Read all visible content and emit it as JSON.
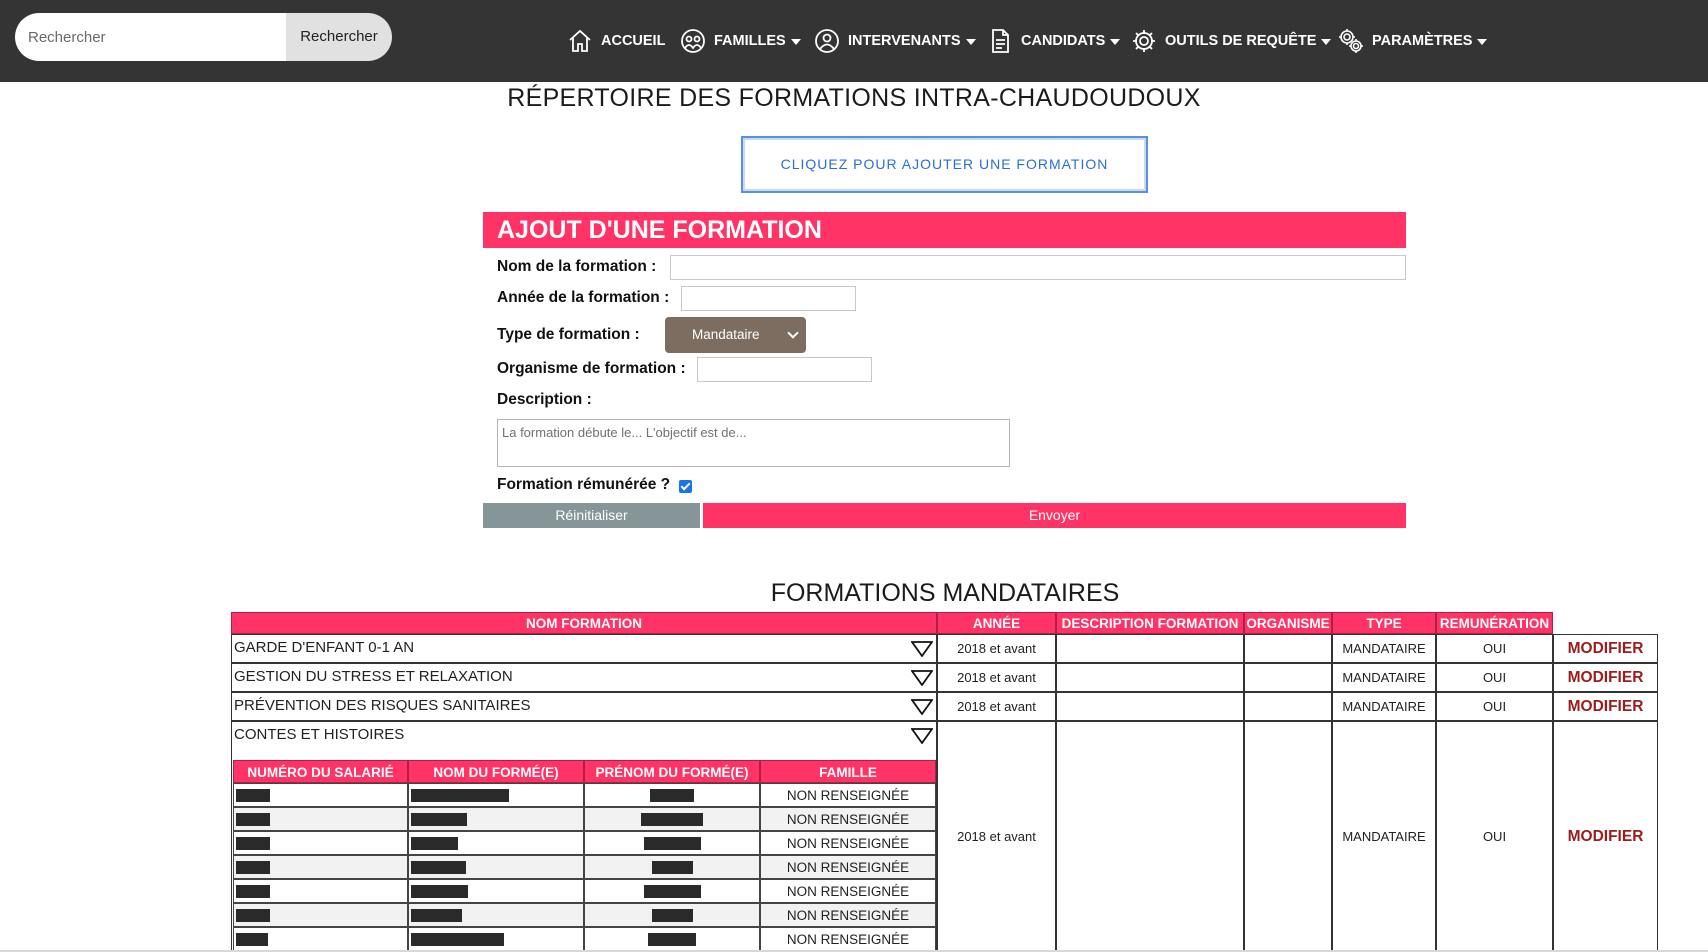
{
  "search": {
    "placeholder": "Rechercher",
    "button_label": "Rechercher"
  },
  "nav": [
    {
      "label": "ACCUEIL",
      "icon": "home-icon",
      "dropdown": false
    },
    {
      "label": "FAMILLES",
      "icon": "family-icon",
      "dropdown": true
    },
    {
      "label": "INTERVENANTS",
      "icon": "user-icon",
      "dropdown": true
    },
    {
      "label": "CANDIDATS",
      "icon": "document-icon",
      "dropdown": true
    },
    {
      "label": "OUTILS DE REQUÊTE",
      "icon": "gear-icon",
      "dropdown": true
    },
    {
      "label": "PARAMÈTRES",
      "icon": "gears-icon",
      "dropdown": true
    }
  ],
  "page_title": "RÉPERTOIRE DES FORMATIONS INTRA-CHAUDOUDOUX",
  "add_button": "CLIQUEZ POUR AJOUTER UNE FORMATION",
  "form": {
    "header": "AJOUT D'UNE FORMATION",
    "name_label": "Nom de la formation :",
    "name_value": "",
    "year_label": "Année de la formation :",
    "year_value": "",
    "type_label": "Type de formation :",
    "type_value": "Mandataire",
    "org_label": "Organisme de formation :",
    "org_value": "",
    "desc_label": "Description :",
    "desc_placeholder": "La formation débute le... L'objectif est de...",
    "paid_label": "Formation rémunérée ?",
    "paid_checked": true,
    "reset_label": "Réinitialiser",
    "submit_label": "Envoyer"
  },
  "section_title": "FORMATIONS MANDATAIRES",
  "table": {
    "headers": [
      "NOM FORMATION",
      "ANNÉE",
      "DESCRIPTION FORMATION",
      "ORGANISME",
      "TYPE",
      "REMUNÉRATION"
    ],
    "rows": [
      {
        "name": "GARDE D'ENFANT 0-1 AN",
        "year": "2018 et avant",
        "description": "",
        "organisme": "",
        "type": "MANDATAIRE",
        "remuneration": "OUI",
        "action": "MODIFIER"
      },
      {
        "name": "GESTION DU STRESS ET RELAXATION",
        "year": "2018 et avant",
        "description": "",
        "organisme": "",
        "type": "MANDATAIRE",
        "remuneration": "OUI",
        "action": "MODIFIER"
      },
      {
        "name": "PRÉVENTION DES RISQUES SANITAIRES",
        "year": "2018 et avant",
        "description": "",
        "organisme": "",
        "type": "MANDATAIRE",
        "remuneration": "OUI",
        "action": "MODIFIER"
      },
      {
        "name": "CONTES ET HISTOIRES",
        "year": "2018 et avant",
        "description": "",
        "organisme": "",
        "type": "MANDATAIRE",
        "remuneration": "OUI",
        "action": "MODIFIER"
      }
    ],
    "sub_headers": [
      "NUMÉRO DU SALARIÉ",
      "NOM DU FORMÉ(E)",
      "PRÉNOM DU FORMÉ(E)",
      "FAMILLE"
    ],
    "sub_rows": [
      {
        "famille": "NON RENSEIGNÉE"
      },
      {
        "famille": "NON RENSEIGNÉE"
      },
      {
        "famille": "NON RENSEIGNÉE"
      },
      {
        "famille": "NON RENSEIGNÉE"
      },
      {
        "famille": "NON RENSEIGNÉE"
      },
      {
        "famille": "NON RENSEIGNÉE"
      },
      {
        "famille": "NON RENSEIGNÉE"
      }
    ]
  },
  "colors": {
    "accent": "#ff3366",
    "navbar": "#343434",
    "link": "#2a6fd3",
    "modify": "#9b1c1c",
    "select": "#7d6d60",
    "reset": "#869598"
  }
}
